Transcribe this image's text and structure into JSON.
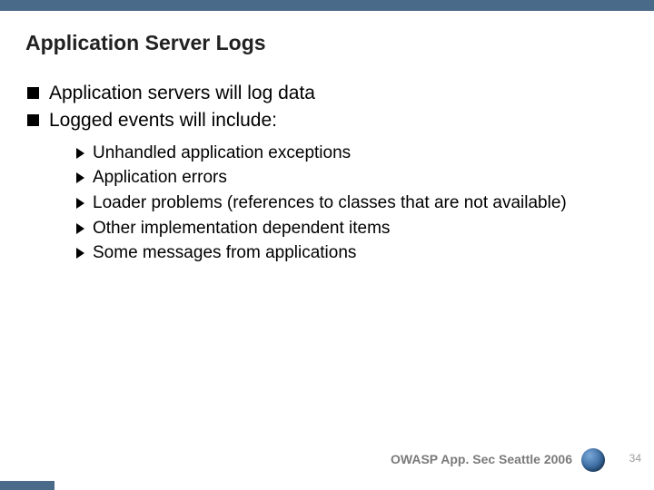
{
  "slide": {
    "title": "Application Server Logs",
    "bullets_l1": [
      "Application servers will log data",
      "Logged events will include:"
    ],
    "bullets_l2": [
      "Unhandled application exceptions",
      "Application errors",
      "Loader problems (references to classes that are not available)",
      "Other implementation dependent items",
      "Some messages from applications"
    ]
  },
  "footer": {
    "text": "OWASP App. Sec Seattle 2006",
    "page": "34"
  }
}
